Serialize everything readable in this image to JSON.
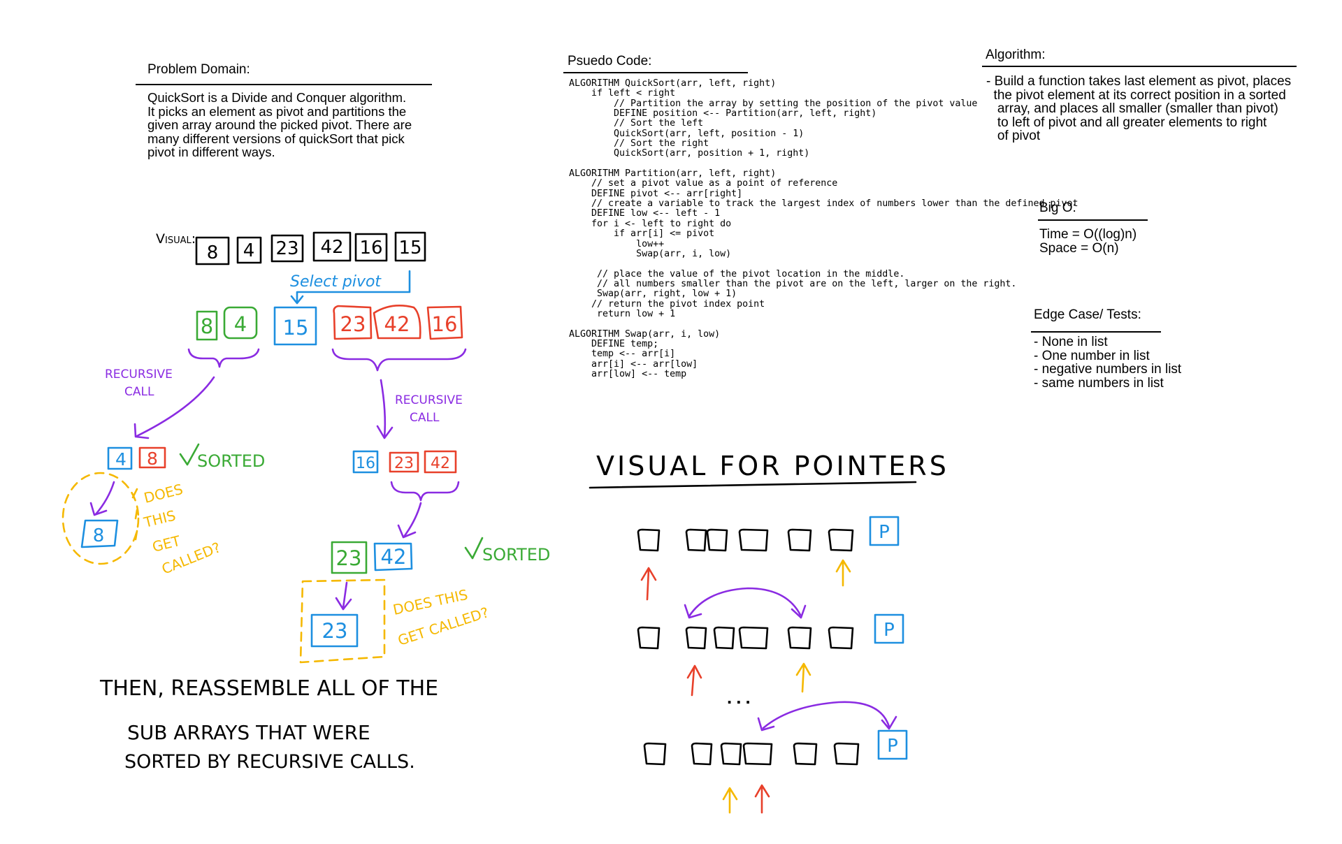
{
  "problem_domain": {
    "heading": "Problem Domain:",
    "lines": [
      "QuickSort is a Divide and Conquer algorithm.",
      "It picks an element as pivot and partitions the",
      "given array around the picked pivot. There are",
      "many different versions of quickSort that pick",
      "pivot in different ways."
    ]
  },
  "pseudo_code": {
    "heading": "Psuedo Code:",
    "lines": [
      "ALGORITHM QuickSort(arr, left, right)",
      "    if left < right",
      "        // Partition the array by setting the position of the pivot value",
      "        DEFINE position <-- Partition(arr, left, right)",
      "        // Sort the left",
      "        QuickSort(arr, left, position - 1)",
      "        // Sort the right",
      "        QuickSort(arr, position + 1, right)",
      "",
      "ALGORITHM Partition(arr, left, right)",
      "    // set a pivot value as a point of reference",
      "    DEFINE pivot <-- arr[right]",
      "    // create a variable to track the largest index of numbers lower than the defined pivot",
      "    DEFINE low <-- left - 1",
      "    for i <- left to right do",
      "        if arr[i] <= pivot",
      "            low++",
      "            Swap(arr, i, low)",
      "",
      "     // place the value of the pivot location in the middle.",
      "     // all numbers smaller than the pivot are on the left, larger on the right.",
      "     Swap(arr, right, low + 1)",
      "    // return the pivot index point",
      "     return low + 1",
      "",
      "ALGORITHM Swap(arr, i, low)",
      "    DEFINE temp;",
      "    temp <-- arr[i]",
      "    arr[i] <-- arr[low]",
      "    arr[low] <-- temp"
    ]
  },
  "algorithm": {
    "heading": "Algorithm:",
    "lines": [
      "- Build a function takes last element as pivot, places",
      "  the pivot element at its correct position in a sorted",
      "   array, and places all smaller (smaller than pivot)",
      "   to left of pivot and all greater elements to right",
      "   of pivot"
    ]
  },
  "big_o": {
    "heading": "Big O:",
    "time": "Time = O((log)n)",
    "space": "Space = O(n)"
  },
  "edge_cases": {
    "heading": "Edge Case/ Tests:",
    "items": [
      "- None in list",
      "- One number in list",
      "- negative numbers in list",
      "- same numbers in list"
    ]
  },
  "sketch": {
    "visual_label": "Visual:",
    "array": [
      "8",
      "4",
      "23",
      "42",
      "16",
      "15"
    ],
    "select_pivot": "Select pivot",
    "pivot": "15",
    "left_partition": [
      "8",
      "4"
    ],
    "right_partition": [
      "23",
      "42",
      "16"
    ],
    "recursive_call": [
      "RECURSIVE",
      "CALL"
    ],
    "left_result": [
      "4",
      "8"
    ],
    "right_result": [
      "16",
      "23",
      "42"
    ],
    "sorted": "SORTED",
    "left_sub": "8",
    "does_this_get_called_stack": [
      "DOES",
      "THIS",
      "GET",
      "CALLED?"
    ],
    "right_sub": [
      "23",
      "42"
    ],
    "right_sub_result": "23",
    "does_this_get_called_lines": [
      "DOES THIS",
      "GET CALLED?"
    ],
    "reassemble_lines": [
      "THEN, REASSEMBLE ALL OF THE",
      "SUB ARRAYS THAT WERE",
      "SORTED  BY RECURSIVE CALLS."
    ],
    "pointers_title": "VISUAL FOR POINTERS",
    "pointer_label": "P",
    "ellipsis": "...",
    "colors": {
      "black": "#000000",
      "blue": "#1d8fe0",
      "green": "#3aaa35",
      "red": "#e8402a",
      "purple": "#8a2be2",
      "orange": "#f5b800"
    }
  }
}
